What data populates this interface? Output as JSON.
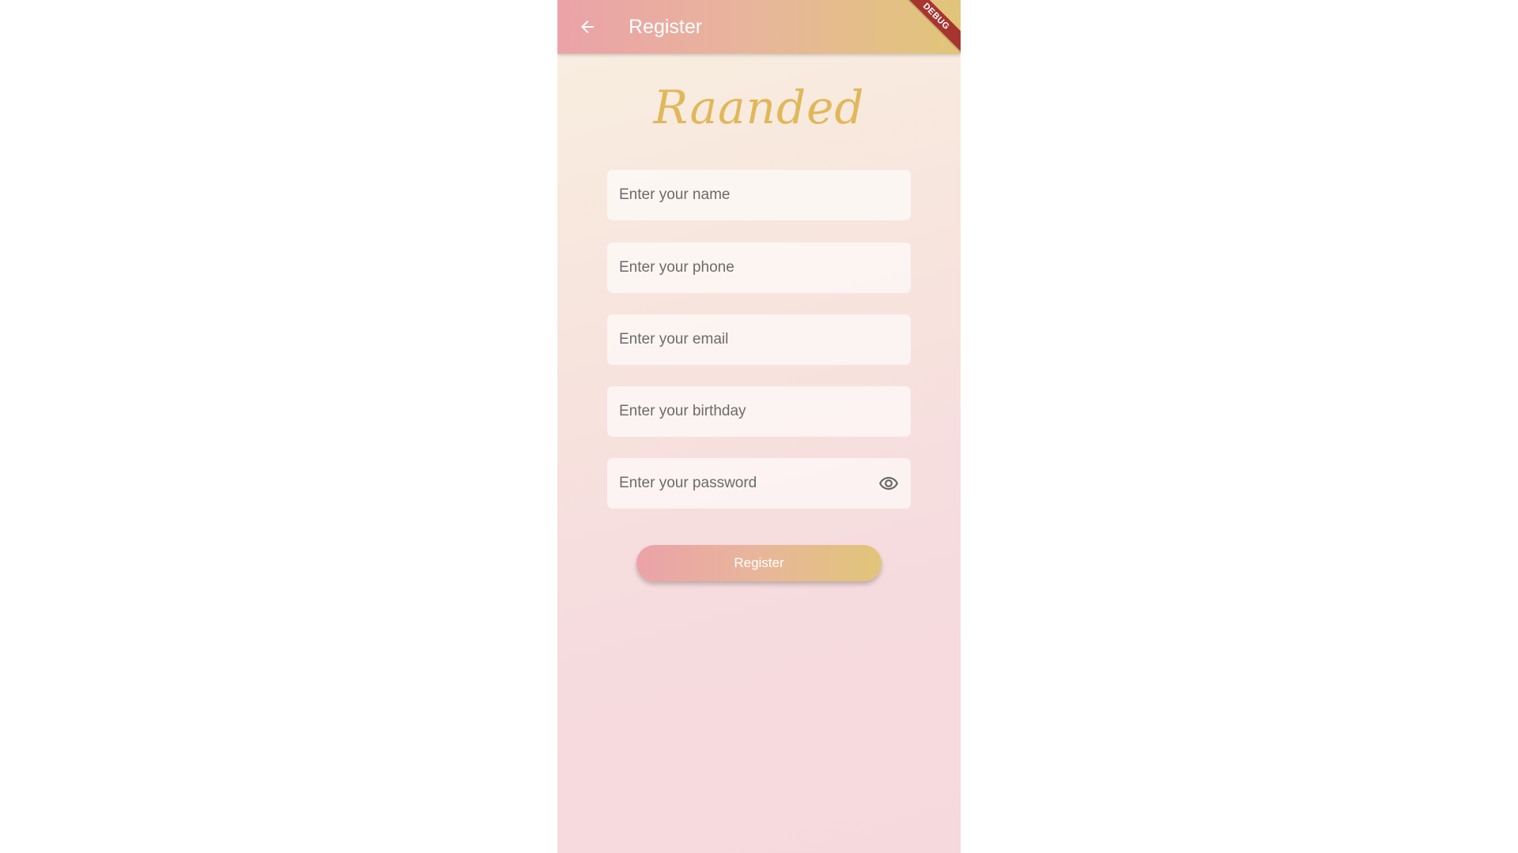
{
  "appbar": {
    "title": "Register",
    "back_icon": "arrow-back-icon",
    "debug_label": "DEBUG",
    "gradient": [
      "#eba2a8",
      "#e8b69a",
      "#e1c579"
    ]
  },
  "logo": {
    "text": "Raanded",
    "color": "#e0b85a"
  },
  "form": {
    "name_placeholder": "Enter your name",
    "phone_placeholder": "Enter your phone",
    "email_placeholder": "Enter your email",
    "birthday_placeholder": "Enter your birthday",
    "password_placeholder": "Enter your password",
    "password_toggle_icon": "eye-icon"
  },
  "actions": {
    "register_label": "Register"
  }
}
